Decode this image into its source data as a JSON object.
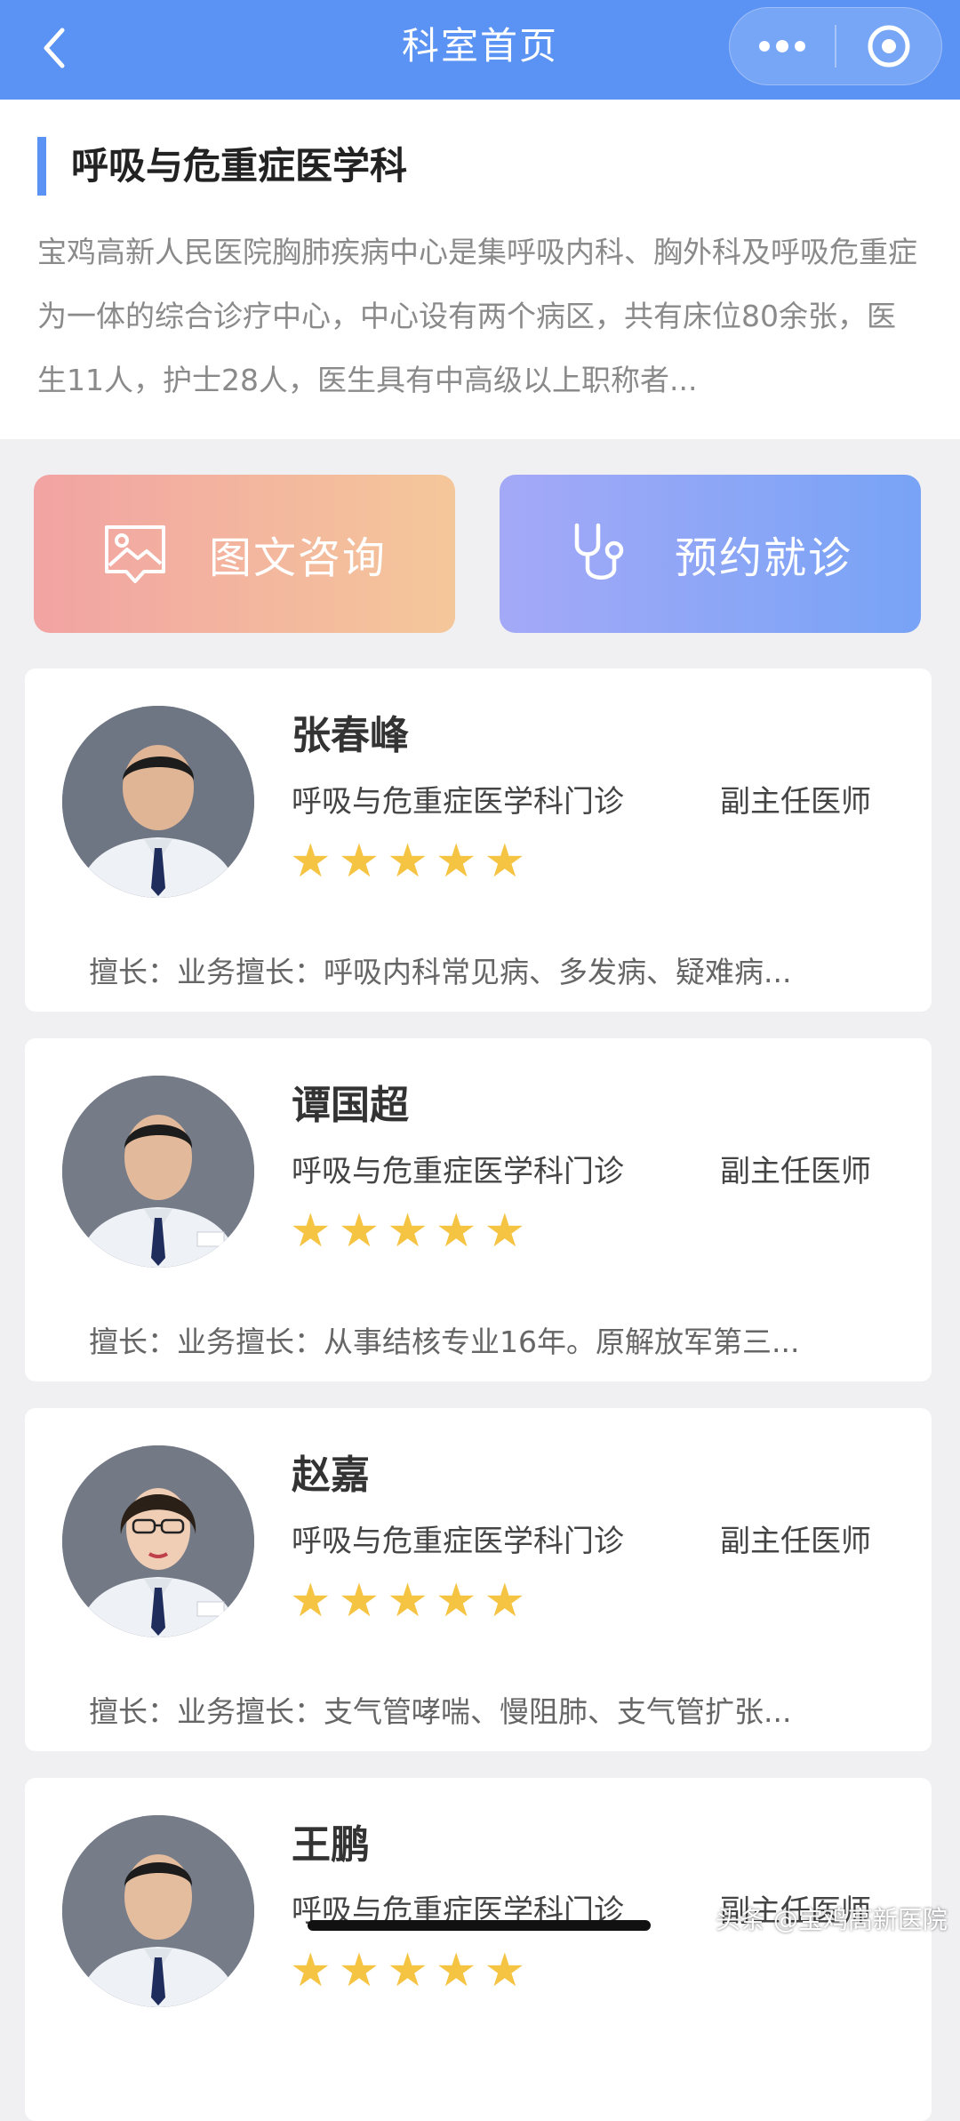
{
  "header": {
    "title": "科室首页",
    "back_icon": "chevron-left-icon",
    "more_icon": "more-dots-icon",
    "close_icon": "target-circle-icon",
    "bg_color": "#5b93f4"
  },
  "department": {
    "name": "呼吸与危重症医学科",
    "description": "宝鸡高新人民医院胸肺疾病中心是集呼吸内科、胸外科及呼吸危重症为一体的综合诊疗中心，中心设有两个病区，共有床位80余张，医生11人，护士28人，医生具有中高级以上职称者..."
  },
  "actions": {
    "consult": {
      "label": "图文咨询",
      "icon": "image-icon"
    },
    "appointment": {
      "label": "预约就诊",
      "icon": "stethoscope-icon"
    }
  },
  "doctors": [
    {
      "name": "张春峰",
      "dept": "呼吸与危重症医学科门诊",
      "title": "副主任医师",
      "rating": 5,
      "skill": "擅长：业务擅长：呼吸内科常见病、多发病、疑难病..."
    },
    {
      "name": "谭国超",
      "dept": "呼吸与危重症医学科门诊",
      "title": "副主任医师",
      "rating": 5,
      "skill": "擅长：业务擅长：从事结核专业16年。原解放军第三..."
    },
    {
      "name": "赵嘉",
      "dept": "呼吸与危重症医学科门诊",
      "title": "副主任医师",
      "rating": 5,
      "skill": "擅长：业务擅长：支气管哮喘、慢阻肺、支气管扩张..."
    },
    {
      "name": "王鹏",
      "dept": "呼吸与危重症医学科门诊",
      "title": "副主任医师",
      "rating": 5,
      "skill": ""
    }
  ],
  "watermark": "头条 @宝鸡高新医院",
  "colors": {
    "accent": "#5b93f4",
    "star": "#f5c443"
  }
}
